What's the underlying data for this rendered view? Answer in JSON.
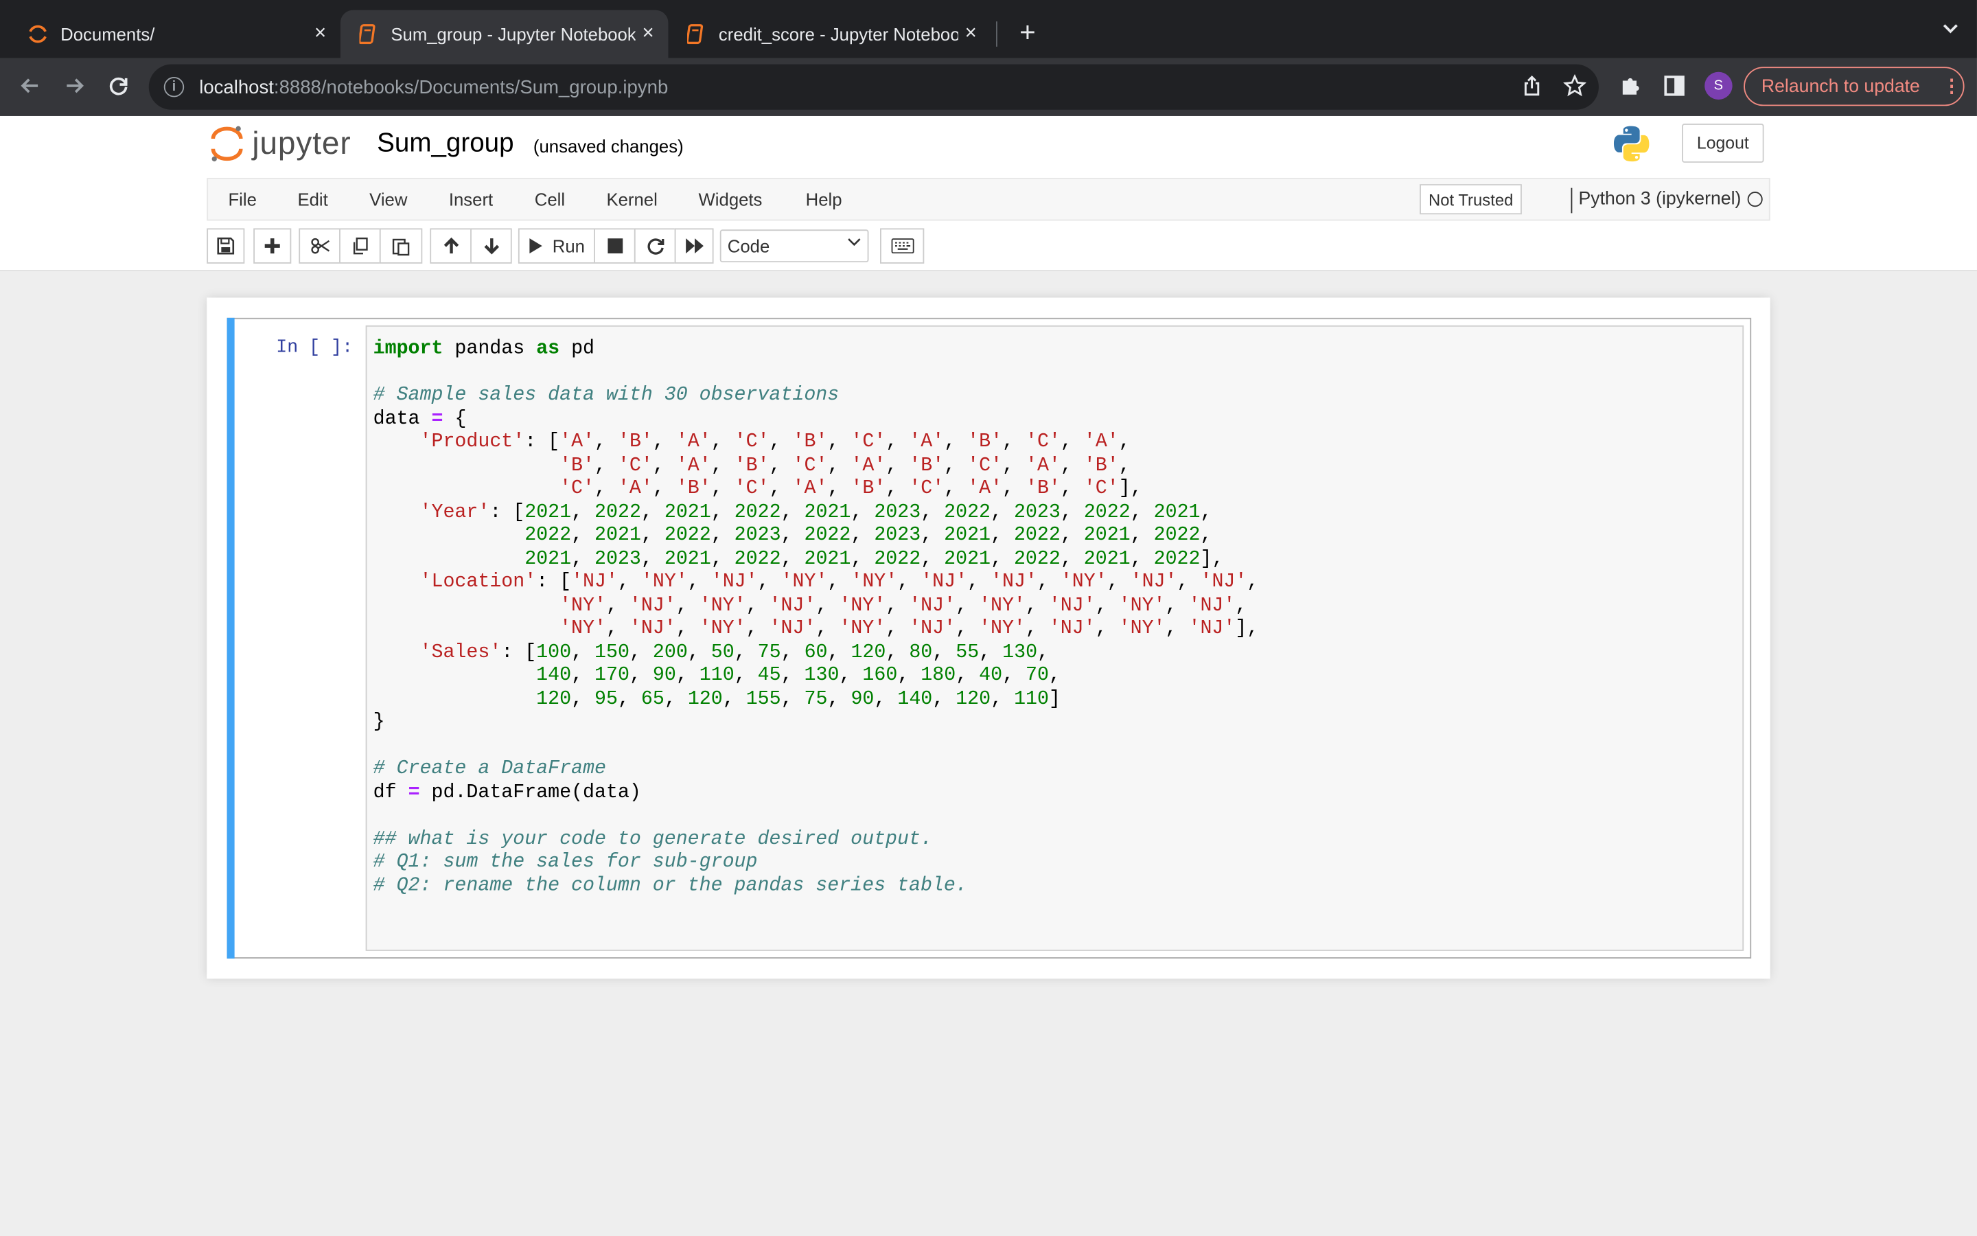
{
  "browser": {
    "tabs": [
      {
        "title": "Documents/",
        "close": "×"
      },
      {
        "title": "Sum_group - Jupyter Notebook",
        "close": "×"
      },
      {
        "title": "credit_score - Jupyter Notebook",
        "close": "×"
      }
    ],
    "new_tab": "+",
    "tab_menu": "⌄",
    "url_host": "localhost",
    "url_rest": ":8888/notebooks/Documents/Sum_group.ipynb",
    "profile_initial": "S",
    "relaunch_label": "Relaunch to update",
    "colors": {
      "tabbar": "#202124",
      "toolbar": "#35363a",
      "relaunch": "#f28b82",
      "profile": "#7b3fb0"
    }
  },
  "header": {
    "logo_text": "jupyter",
    "notebook_name": "Sum_group",
    "save_status": "(unsaved changes)",
    "logout_label": "Logout"
  },
  "menubar": {
    "items": [
      "File",
      "Edit",
      "View",
      "Insert",
      "Cell",
      "Kernel",
      "Widgets",
      "Help"
    ],
    "trust_label": "Not Trusted",
    "kernel_name": "Python 3 (ipykernel)"
  },
  "toolbar": {
    "buttons": [
      "save-icon",
      "add-cell-icon",
      "cut-icon",
      "copy-icon",
      "paste-icon",
      "move-up-icon",
      "move-down-icon",
      "run-icon",
      "stop-icon",
      "restart-icon",
      "fast-forward-icon",
      "keyboard-icon"
    ],
    "run_label": "Run",
    "cell_type": "Code"
  },
  "cell": {
    "prompt": "In [ ]:",
    "lines": [
      [
        [
          "kw",
          "import"
        ],
        [
          "t",
          " pandas "
        ],
        [
          "kw",
          "as"
        ],
        [
          "t",
          " pd"
        ]
      ],
      [],
      [
        [
          "cm",
          "# Sample sales data with 30 observations"
        ]
      ],
      [
        [
          "t",
          "data "
        ],
        [
          "op",
          "="
        ],
        [
          "t",
          " {"
        ]
      ],
      [
        [
          "t",
          "    "
        ],
        [
          "str",
          "'Product'"
        ],
        [
          "t",
          ": ["
        ],
        [
          "str",
          "'A'"
        ],
        [
          "t",
          ", "
        ],
        [
          "str",
          "'B'"
        ],
        [
          "t",
          ", "
        ],
        [
          "str",
          "'A'"
        ],
        [
          "t",
          ", "
        ],
        [
          "str",
          "'C'"
        ],
        [
          "t",
          ", "
        ],
        [
          "str",
          "'B'"
        ],
        [
          "t",
          ", "
        ],
        [
          "str",
          "'C'"
        ],
        [
          "t",
          ", "
        ],
        [
          "str",
          "'A'"
        ],
        [
          "t",
          ", "
        ],
        [
          "str",
          "'B'"
        ],
        [
          "t",
          ", "
        ],
        [
          "str",
          "'C'"
        ],
        [
          "t",
          ", "
        ],
        [
          "str",
          "'A'"
        ],
        [
          "t",
          ","
        ]
      ],
      [
        [
          "t",
          "                "
        ],
        [
          "str",
          "'B'"
        ],
        [
          "t",
          ", "
        ],
        [
          "str",
          "'C'"
        ],
        [
          "t",
          ", "
        ],
        [
          "str",
          "'A'"
        ],
        [
          "t",
          ", "
        ],
        [
          "str",
          "'B'"
        ],
        [
          "t",
          ", "
        ],
        [
          "str",
          "'C'"
        ],
        [
          "t",
          ", "
        ],
        [
          "str",
          "'A'"
        ],
        [
          "t",
          ", "
        ],
        [
          "str",
          "'B'"
        ],
        [
          "t",
          ", "
        ],
        [
          "str",
          "'C'"
        ],
        [
          "t",
          ", "
        ],
        [
          "str",
          "'A'"
        ],
        [
          "t",
          ", "
        ],
        [
          "str",
          "'B'"
        ],
        [
          "t",
          ","
        ]
      ],
      [
        [
          "t",
          "                "
        ],
        [
          "str",
          "'C'"
        ],
        [
          "t",
          ", "
        ],
        [
          "str",
          "'A'"
        ],
        [
          "t",
          ", "
        ],
        [
          "str",
          "'B'"
        ],
        [
          "t",
          ", "
        ],
        [
          "str",
          "'C'"
        ],
        [
          "t",
          ", "
        ],
        [
          "str",
          "'A'"
        ],
        [
          "t",
          ", "
        ],
        [
          "str",
          "'B'"
        ],
        [
          "t",
          ", "
        ],
        [
          "str",
          "'C'"
        ],
        [
          "t",
          ", "
        ],
        [
          "str",
          "'A'"
        ],
        [
          "t",
          ", "
        ],
        [
          "str",
          "'B'"
        ],
        [
          "t",
          ", "
        ],
        [
          "str",
          "'C'"
        ],
        [
          "t",
          "],"
        ]
      ],
      [
        [
          "t",
          "    "
        ],
        [
          "str",
          "'Year'"
        ],
        [
          "t",
          ": ["
        ],
        [
          "num",
          "2021"
        ],
        [
          "t",
          ", "
        ],
        [
          "num",
          "2022"
        ],
        [
          "t",
          ", "
        ],
        [
          "num",
          "2021"
        ],
        [
          "t",
          ", "
        ],
        [
          "num",
          "2022"
        ],
        [
          "t",
          ", "
        ],
        [
          "num",
          "2021"
        ],
        [
          "t",
          ", "
        ],
        [
          "num",
          "2023"
        ],
        [
          "t",
          ", "
        ],
        [
          "num",
          "2022"
        ],
        [
          "t",
          ", "
        ],
        [
          "num",
          "2023"
        ],
        [
          "t",
          ", "
        ],
        [
          "num",
          "2022"
        ],
        [
          "t",
          ", "
        ],
        [
          "num",
          "2021"
        ],
        [
          "t",
          ","
        ]
      ],
      [
        [
          "t",
          "             "
        ],
        [
          "num",
          "2022"
        ],
        [
          "t",
          ", "
        ],
        [
          "num",
          "2021"
        ],
        [
          "t",
          ", "
        ],
        [
          "num",
          "2022"
        ],
        [
          "t",
          ", "
        ],
        [
          "num",
          "2023"
        ],
        [
          "t",
          ", "
        ],
        [
          "num",
          "2022"
        ],
        [
          "t",
          ", "
        ],
        [
          "num",
          "2023"
        ],
        [
          "t",
          ", "
        ],
        [
          "num",
          "2021"
        ],
        [
          "t",
          ", "
        ],
        [
          "num",
          "2022"
        ],
        [
          "t",
          ", "
        ],
        [
          "num",
          "2021"
        ],
        [
          "t",
          ", "
        ],
        [
          "num",
          "2022"
        ],
        [
          "t",
          ","
        ]
      ],
      [
        [
          "t",
          "             "
        ],
        [
          "num",
          "2021"
        ],
        [
          "t",
          ", "
        ],
        [
          "num",
          "2023"
        ],
        [
          "t",
          ", "
        ],
        [
          "num",
          "2021"
        ],
        [
          "t",
          ", "
        ],
        [
          "num",
          "2022"
        ],
        [
          "t",
          ", "
        ],
        [
          "num",
          "2021"
        ],
        [
          "t",
          ", "
        ],
        [
          "num",
          "2022"
        ],
        [
          "t",
          ", "
        ],
        [
          "num",
          "2021"
        ],
        [
          "t",
          ", "
        ],
        [
          "num",
          "2022"
        ],
        [
          "t",
          ", "
        ],
        [
          "num",
          "2021"
        ],
        [
          "t",
          ", "
        ],
        [
          "num",
          "2022"
        ],
        [
          "t",
          "],"
        ]
      ],
      [
        [
          "t",
          "    "
        ],
        [
          "str",
          "'Location'"
        ],
        [
          "t",
          ": ["
        ],
        [
          "str",
          "'NJ'"
        ],
        [
          "t",
          ", "
        ],
        [
          "str",
          "'NY'"
        ],
        [
          "t",
          ", "
        ],
        [
          "str",
          "'NJ'"
        ],
        [
          "t",
          ", "
        ],
        [
          "str",
          "'NY'"
        ],
        [
          "t",
          ", "
        ],
        [
          "str",
          "'NY'"
        ],
        [
          "t",
          ", "
        ],
        [
          "str",
          "'NJ'"
        ],
        [
          "t",
          ", "
        ],
        [
          "str",
          "'NJ'"
        ],
        [
          "t",
          ", "
        ],
        [
          "str",
          "'NY'"
        ],
        [
          "t",
          ", "
        ],
        [
          "str",
          "'NJ'"
        ],
        [
          "t",
          ", "
        ],
        [
          "str",
          "'NJ'"
        ],
        [
          "t",
          ","
        ]
      ],
      [
        [
          "t",
          "                "
        ],
        [
          "str",
          "'NY'"
        ],
        [
          "t",
          ", "
        ],
        [
          "str",
          "'NJ'"
        ],
        [
          "t",
          ", "
        ],
        [
          "str",
          "'NY'"
        ],
        [
          "t",
          ", "
        ],
        [
          "str",
          "'NJ'"
        ],
        [
          "t",
          ", "
        ],
        [
          "str",
          "'NY'"
        ],
        [
          "t",
          ", "
        ],
        [
          "str",
          "'NJ'"
        ],
        [
          "t",
          ", "
        ],
        [
          "str",
          "'NY'"
        ],
        [
          "t",
          ", "
        ],
        [
          "str",
          "'NJ'"
        ],
        [
          "t",
          ", "
        ],
        [
          "str",
          "'NY'"
        ],
        [
          "t",
          ", "
        ],
        [
          "str",
          "'NJ'"
        ],
        [
          "t",
          ","
        ]
      ],
      [
        [
          "t",
          "                "
        ],
        [
          "str",
          "'NY'"
        ],
        [
          "t",
          ", "
        ],
        [
          "str",
          "'NJ'"
        ],
        [
          "t",
          ", "
        ],
        [
          "str",
          "'NY'"
        ],
        [
          "t",
          ", "
        ],
        [
          "str",
          "'NJ'"
        ],
        [
          "t",
          ", "
        ],
        [
          "str",
          "'NY'"
        ],
        [
          "t",
          ", "
        ],
        [
          "str",
          "'NJ'"
        ],
        [
          "t",
          ", "
        ],
        [
          "str",
          "'NY'"
        ],
        [
          "t",
          ", "
        ],
        [
          "str",
          "'NJ'"
        ],
        [
          "t",
          ", "
        ],
        [
          "str",
          "'NY'"
        ],
        [
          "t",
          ", "
        ],
        [
          "str",
          "'NJ'"
        ],
        [
          "t",
          "],"
        ]
      ],
      [
        [
          "t",
          "    "
        ],
        [
          "str",
          "'Sales'"
        ],
        [
          "t",
          ": ["
        ],
        [
          "num",
          "100"
        ],
        [
          "t",
          ", "
        ],
        [
          "num",
          "150"
        ],
        [
          "t",
          ", "
        ],
        [
          "num",
          "200"
        ],
        [
          "t",
          ", "
        ],
        [
          "num",
          "50"
        ],
        [
          "t",
          ", "
        ],
        [
          "num",
          "75"
        ],
        [
          "t",
          ", "
        ],
        [
          "num",
          "60"
        ],
        [
          "t",
          ", "
        ],
        [
          "num",
          "120"
        ],
        [
          "t",
          ", "
        ],
        [
          "num",
          "80"
        ],
        [
          "t",
          ", "
        ],
        [
          "num",
          "55"
        ],
        [
          "t",
          ", "
        ],
        [
          "num",
          "130"
        ],
        [
          "t",
          ","
        ]
      ],
      [
        [
          "t",
          "              "
        ],
        [
          "num",
          "140"
        ],
        [
          "t",
          ", "
        ],
        [
          "num",
          "170"
        ],
        [
          "t",
          ", "
        ],
        [
          "num",
          "90"
        ],
        [
          "t",
          ", "
        ],
        [
          "num",
          "110"
        ],
        [
          "t",
          ", "
        ],
        [
          "num",
          "45"
        ],
        [
          "t",
          ", "
        ],
        [
          "num",
          "130"
        ],
        [
          "t",
          ", "
        ],
        [
          "num",
          "160"
        ],
        [
          "t",
          ", "
        ],
        [
          "num",
          "180"
        ],
        [
          "t",
          ", "
        ],
        [
          "num",
          "40"
        ],
        [
          "t",
          ", "
        ],
        [
          "num",
          "70"
        ],
        [
          "t",
          ","
        ]
      ],
      [
        [
          "t",
          "              "
        ],
        [
          "num",
          "120"
        ],
        [
          "t",
          ", "
        ],
        [
          "num",
          "95"
        ],
        [
          "t",
          ", "
        ],
        [
          "num",
          "65"
        ],
        [
          "t",
          ", "
        ],
        [
          "num",
          "120"
        ],
        [
          "t",
          ", "
        ],
        [
          "num",
          "155"
        ],
        [
          "t",
          ", "
        ],
        [
          "num",
          "75"
        ],
        [
          "t",
          ", "
        ],
        [
          "num",
          "90"
        ],
        [
          "t",
          ", "
        ],
        [
          "num",
          "140"
        ],
        [
          "t",
          ", "
        ],
        [
          "num",
          "120"
        ],
        [
          "t",
          ", "
        ],
        [
          "num",
          "110"
        ],
        [
          "t",
          "]"
        ]
      ],
      [
        [
          "t",
          "}"
        ]
      ],
      [],
      [
        [
          "cm",
          "# Create a DataFrame"
        ]
      ],
      [
        [
          "t",
          "df "
        ],
        [
          "op",
          "="
        ],
        [
          "t",
          " pd.DataFrame(data)"
        ]
      ],
      [],
      [
        [
          "cm",
          "## what is your code to generate desired output."
        ]
      ],
      [
        [
          "cm",
          "# Q1: sum the sales for sub-group"
        ]
      ],
      [
        [
          "cm",
          "# Q2: rename the column or the pandas series table."
        ]
      ]
    ]
  }
}
